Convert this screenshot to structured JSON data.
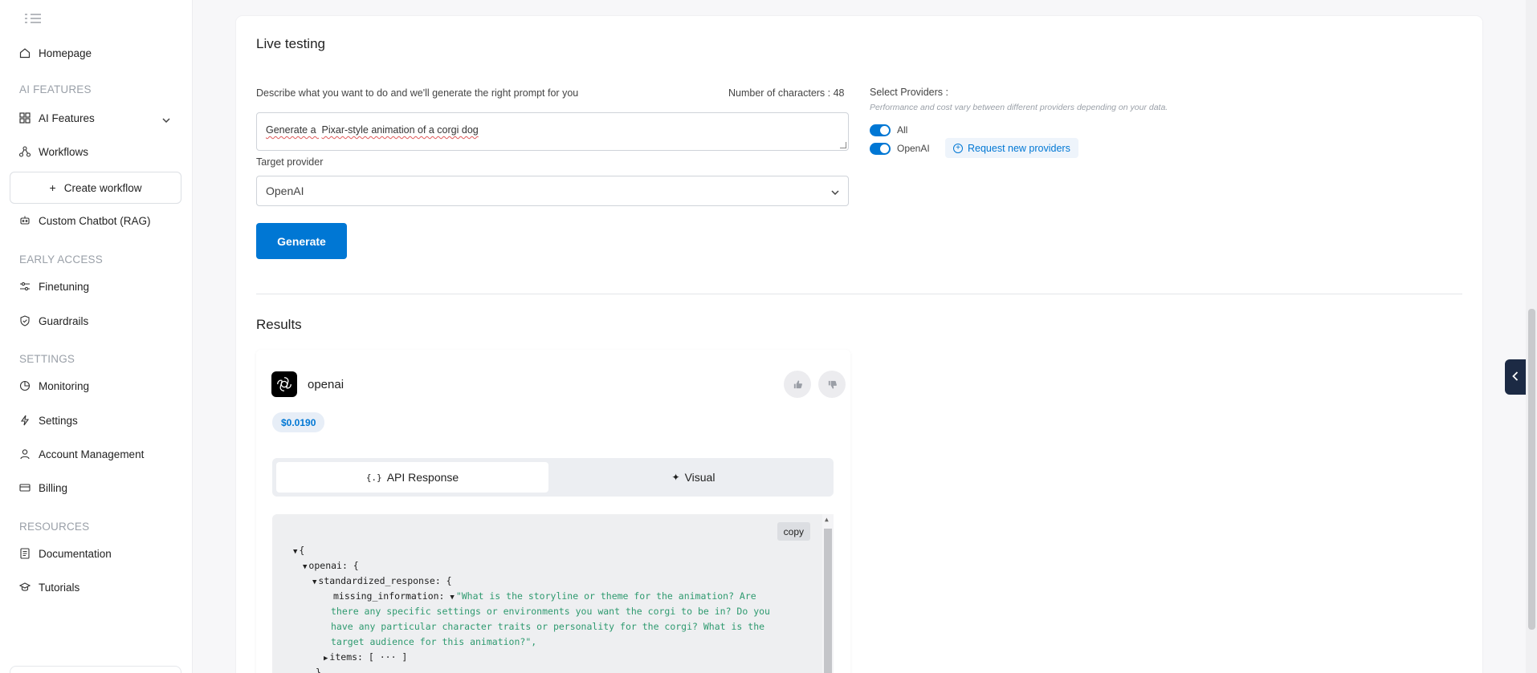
{
  "sidebar": {
    "homepage": "Homepage",
    "section_ai": "AI FEATURES",
    "ai_features": "AI Features",
    "workflows": "Workflows",
    "create_workflow": "Create workflow",
    "custom_chatbot": "Custom Chatbot (RAG)",
    "section_early": "EARLY ACCESS",
    "finetuning": "Finetuning",
    "guardrails": "Guardrails",
    "section_settings": "SETTINGS",
    "monitoring": "Monitoring",
    "settings": "Settings",
    "account": "Account Management",
    "billing": "Billing",
    "section_resources": "RESOURCES",
    "documentation": "Documentation",
    "tutorials": "Tutorials"
  },
  "live": {
    "title": "Live testing",
    "describe_label": "Describe what you want to do and we'll generate the right prompt for you",
    "char_count": "Number of characters : 48",
    "prompt_prefix": "Generate a ",
    "prompt_text": "Pixar-style animation of a corgi dog",
    "target_label": "Target provider",
    "target_value": "OpenAI",
    "generate": "Generate",
    "providers_label": "Select Providers :",
    "providers_note": "Performance and cost vary between different providers depending on your data.",
    "toggle_all": "All",
    "toggle_openai": "OpenAI",
    "request_providers": "Request new providers"
  },
  "results": {
    "title": "Results",
    "provider": "openai",
    "price": "$0.0190",
    "tab_api": "API Response",
    "tab_visual": "Visual",
    "copy": "copy",
    "code": {
      "l1": "{",
      "l2": "openai: {",
      "l3": "standardized_response: {",
      "l4_key": "missing_information: ",
      "l4_val": "\"What is the storyline or theme for the animation? Are",
      "l5": "there any specific settings or environments you want the corgi to be in? Do you",
      "l6": "have any particular character traits or personality for the corgi? What is the",
      "l7": "target audience for this animation?\",",
      "l8": "items: [ ··· ]",
      "l9": "}"
    }
  },
  "colors": {
    "accent": "#0077d4",
    "string": "#2e9a6f",
    "panel_tab": "#1c2a44"
  }
}
